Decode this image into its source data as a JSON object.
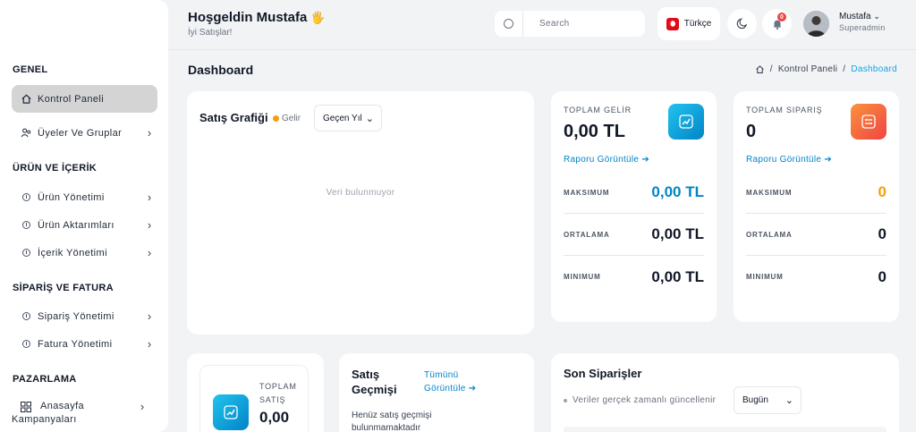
{
  "header": {
    "greeting": "Hoşgeldin Mustafa",
    "greeting_emoji": "🖐",
    "subtitle": "İyi Satışlar!",
    "search_placeholder": "Search",
    "language": "Türkçe",
    "notification_count": "0",
    "user_name": "Mustafa",
    "user_role": "Superadmin"
  },
  "sidebar": {
    "sections": [
      {
        "title": "GENEL",
        "items": [
          {
            "label": "Kontrol Paneli",
            "icon": "home-icon",
            "active": true,
            "has_chevron": false
          },
          {
            "label": "Üyeler Ve Gruplar",
            "icon": "users-icon",
            "active": false,
            "has_chevron": true
          }
        ]
      },
      {
        "title": "ÜRÜN VE İÇERİK",
        "items": [
          {
            "label": "Ürün Yönetimi",
            "icon": "circle-info-icon",
            "has_chevron": true
          },
          {
            "label": "Ürün Aktarımları",
            "icon": "circle-info-icon",
            "has_chevron": true
          },
          {
            "label": "İçerik Yönetimi",
            "icon": "circle-info-icon",
            "has_chevron": true
          }
        ]
      },
      {
        "title": "SİPARİŞ VE FATURA",
        "items": [
          {
            "label": "Sipariş Yönetimi",
            "icon": "circle-info-icon",
            "has_chevron": true
          },
          {
            "label": "Fatura Yönetimi",
            "icon": "circle-info-icon",
            "has_chevron": true
          }
        ]
      },
      {
        "title": "PAZARLAMA",
        "items": [
          {
            "label": "Anasayfa Kampanyaları",
            "icon": "grid-icon",
            "has_chevron": true
          }
        ]
      }
    ]
  },
  "page": {
    "title": "Dashboard",
    "breadcrumb": [
      "Kontrol Paneli",
      "Dashboard"
    ]
  },
  "sales_chart": {
    "title": "Satış Grafiği",
    "legend": "Gelir",
    "period": "Geçen Yıl",
    "empty_text": "Veri bulunmuyor"
  },
  "revenue_card": {
    "label": "TOPLAM GELİR",
    "value": "0,00 TL",
    "link": "Raporu Görüntüle",
    "rows": [
      {
        "key": "MAKSIMUM",
        "value": "0,00 TL"
      },
      {
        "key": "ORTALAMA",
        "value": "0,00 TL"
      },
      {
        "key": "MINIMUM",
        "value": "0,00 TL"
      }
    ]
  },
  "orders_stat_card": {
    "label": "TOPLAM SIPARIŞ",
    "value": "0",
    "link": "Raporu Görüntüle",
    "rows": [
      {
        "key": "MAKSIMUM",
        "value": "0"
      },
      {
        "key": "ORTALAMA",
        "value": "0"
      },
      {
        "key": "MINIMUM",
        "value": "0"
      }
    ]
  },
  "total_sales_mini": {
    "label": "TOPLAM SATIŞ",
    "value": "0,00"
  },
  "sales_history": {
    "title": "Satış Geçmişi",
    "link": "Tümünü Görüntüle",
    "empty_text": "Henüz satış geçmişi bulunmamaktadır"
  },
  "recent_orders": {
    "title": "Son Siparişler",
    "note": "Veriler gerçek zamanlı güncellenir",
    "filter": "Bugün"
  }
}
